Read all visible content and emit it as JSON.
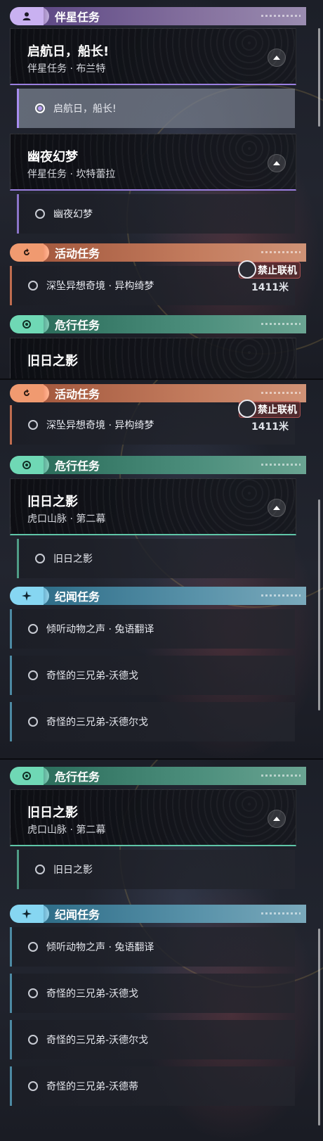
{
  "categories": {
    "companion": "伴星任务",
    "event": "活动任务",
    "danger": "危行任务",
    "chronicle": "纪闻任务"
  },
  "quests": {
    "departure": {
      "title": "启航日，船长!",
      "subtitle": "伴星任务 · 布兰特",
      "step": "启航日，船长!"
    },
    "nightdream": {
      "title": "幽夜幻梦",
      "subtitle": "伴星任务 · 坎特蕾拉",
      "step": "幽夜幻梦"
    },
    "abyss": {
      "step": "深坠异想奇境 · 异构绮梦",
      "badge": "禁止联机",
      "distance": "1411米"
    },
    "shadow": {
      "title": "旧日之影",
      "title_cut": "旧日之影",
      "subtitle": "虎口山脉 · 第二幕",
      "step": "旧日之影"
    },
    "chronicle_steps": [
      "倾听动物之声 · 兔语翻译",
      "奇怪的三兄弟-沃德戈",
      "奇怪的三兄弟-沃德尔戈",
      "奇怪的三兄弟-沃德蒂"
    ]
  },
  "colors": {
    "companion": "#c9b1f1",
    "event": "#f09a70",
    "danger": "#6fd8b5",
    "chronicle": "#86d6f2"
  },
  "icons": {
    "companion": "person-icon",
    "event": "refresh-icon",
    "danger": "hazard-icon",
    "chronicle": "sparkle-icon",
    "collapse": "chevron-up-icon",
    "lock": "no-multiplayer-icon"
  }
}
